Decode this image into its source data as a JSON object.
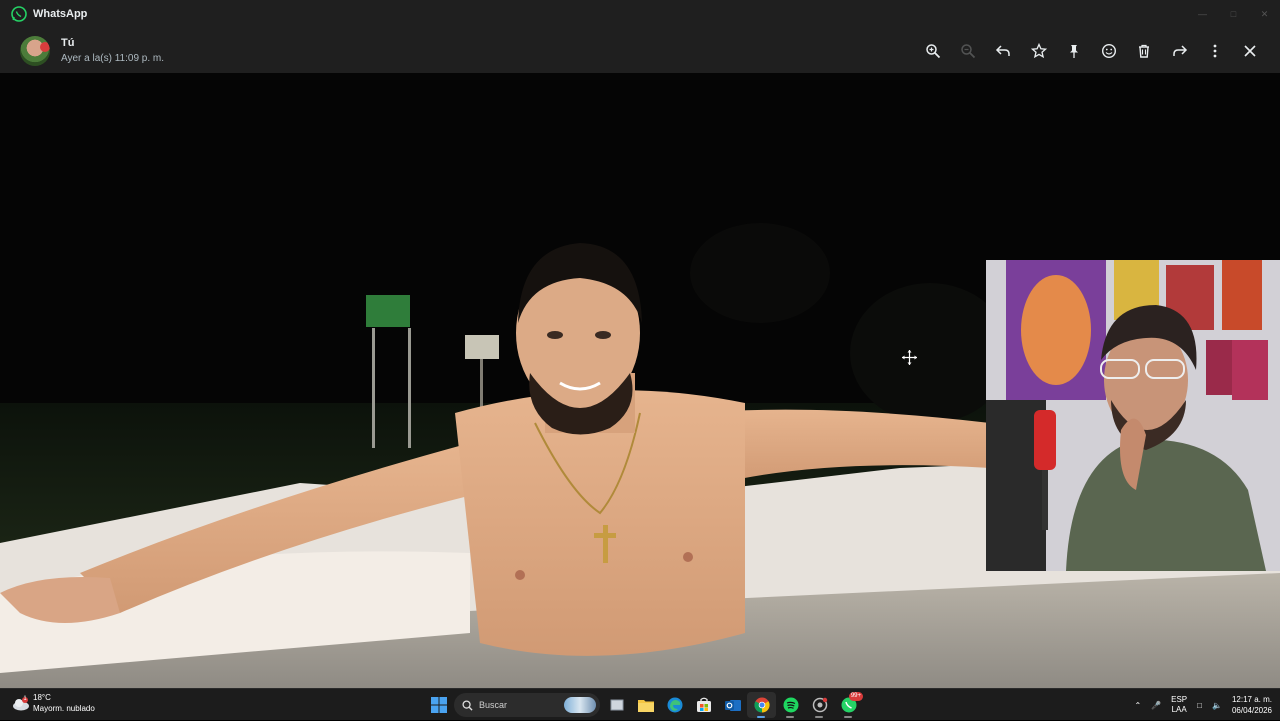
{
  "window": {
    "app_name": "WhatsApp"
  },
  "header": {
    "sender_name": "Tú",
    "sender_time": "Ayer a la(s) 11:09 p. m.",
    "toolbar": [
      "zoom-in-icon",
      "zoom-out-icon",
      "reply-icon",
      "star-icon",
      "pin-icon",
      "emoji-icon",
      "delete-icon",
      "forward-icon",
      "more-icon",
      "close-icon"
    ]
  },
  "taskbar": {
    "weather_temp": "18°C",
    "weather_desc": "Mayorm. nublado",
    "weather_alert": "1",
    "search_placeholder": "Buscar",
    "whatsapp_badge": "99+",
    "language_top": "ESP",
    "language_bottom": "LAA",
    "time": "12:17 a. m.",
    "date": "06/04/2026"
  },
  "colors": {
    "whatsapp_green": "#25d366",
    "bar_bg": "#1f1f1f",
    "taskbar_bg": "#1c1c1c"
  }
}
